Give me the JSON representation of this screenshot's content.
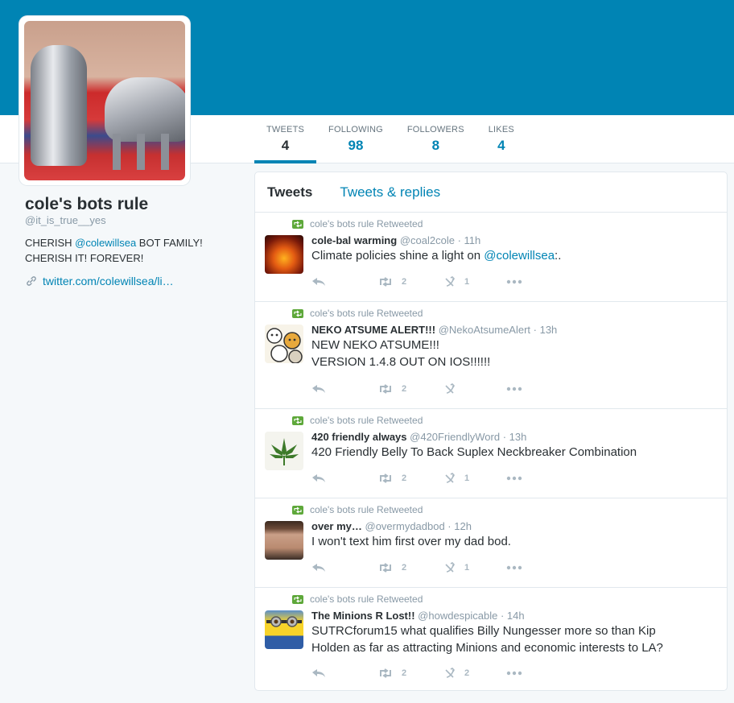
{
  "profile": {
    "name": "cole's bots rule",
    "handle": "@it_is_true__yes",
    "bio_prefix": "CHERISH ",
    "bio_mention": "@colewillsea",
    "bio_suffix": " BOT FAMILY! CHERISH IT! FOREVER!",
    "url": "twitter.com/colewillsea/li…"
  },
  "stats": [
    {
      "label": "TWEETS",
      "value": "4"
    },
    {
      "label": "FOLLOWING",
      "value": "98"
    },
    {
      "label": "FOLLOWERS",
      "value": "8"
    },
    {
      "label": "LIKES",
      "value": "4"
    }
  ],
  "timeline": {
    "tabs": [
      "Tweets",
      "Tweets & replies"
    ],
    "tweets": [
      {
        "retweeted_by": "cole's bots rule Retweeted",
        "name": "cole-bal warming",
        "meta": "@coal2cole · 11h",
        "text_before": "Climate policies shine a light on ",
        "mention": "@colewillsea",
        "text_after": ":.",
        "retweets": "2",
        "likes": "1"
      },
      {
        "retweeted_by": "cole's bots rule Retweeted",
        "name": "NEKO ATSUME ALERT!!!",
        "meta": "@NekoAtsumeAlert · 13h",
        "line1": "NEW NEKO ATSUME!!!",
        "line2": "VERSION 1.4.8 OUT ON IOS!!!!!!",
        "retweets": "2",
        "likes": ""
      },
      {
        "retweeted_by": "cole's bots rule Retweeted",
        "name": "420 friendly always",
        "meta": "@420FriendlyWord · 13h",
        "text": "420 Friendly Belly To Back Suplex Neckbreaker Combination",
        "retweets": "2",
        "likes": "1"
      },
      {
        "retweeted_by": "cole's bots rule Retweeted",
        "name": "over my…",
        "meta": "@overmydadbod · 12h",
        "text": "I won't text him first over my dad bod.",
        "retweets": "2",
        "likes": "1"
      },
      {
        "retweeted_by": "cole's bots rule Retweeted",
        "name": "The Minions R Lost!!",
        "meta": "@howdespicable · 14h",
        "line1": "SUTRCforum15 what qualifies Billy Nungesser more so than Kip",
        "line2": "Holden as far as attracting Minions and economic interests to LA?",
        "retweets": "2",
        "likes": "2"
      }
    ]
  },
  "colors": {
    "banner": "#0084b4",
    "link": "#0084b4",
    "retweet_green": "#5ea83a",
    "muted": "#8899a6"
  },
  "icons": [
    "link-icon",
    "retweet-icon",
    "reply-icon",
    "like-icon",
    "more-icon"
  ]
}
